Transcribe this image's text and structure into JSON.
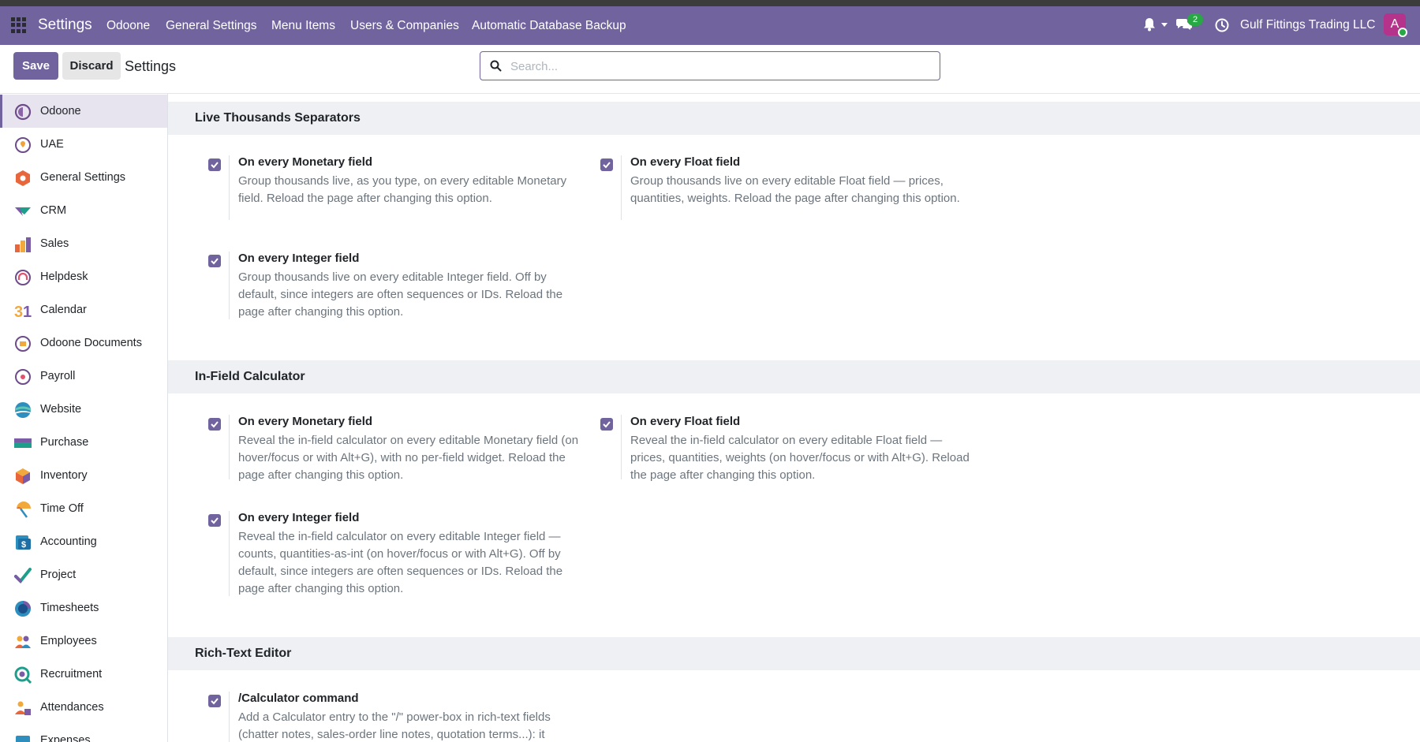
{
  "navbar": {
    "brand": "Settings",
    "menus": [
      "Odoone",
      "General Settings",
      "Menu Items",
      "Users & Companies",
      "Automatic Database Backup"
    ],
    "messages_count": "2",
    "company": "Gulf Fittings Trading LLC",
    "avatar_letter": "A"
  },
  "controls": {
    "save": "Save",
    "discard": "Discard",
    "title": "Settings",
    "search_placeholder": "Search..."
  },
  "sidebar": {
    "items": [
      {
        "label": "Odoone",
        "icon": "odoone-icon",
        "active": true
      },
      {
        "label": "UAE",
        "icon": "uae-icon"
      },
      {
        "label": "General Settings",
        "icon": "general-settings-icon"
      },
      {
        "label": "CRM",
        "icon": "crm-icon"
      },
      {
        "label": "Sales",
        "icon": "sales-icon"
      },
      {
        "label": "Helpdesk",
        "icon": "helpdesk-icon"
      },
      {
        "label": "Calendar",
        "icon": "calendar-icon"
      },
      {
        "label": "Odoone Documents",
        "icon": "documents-icon"
      },
      {
        "label": "Payroll",
        "icon": "payroll-icon"
      },
      {
        "label": "Website",
        "icon": "website-icon"
      },
      {
        "label": "Purchase",
        "icon": "purchase-icon"
      },
      {
        "label": "Inventory",
        "icon": "inventory-icon"
      },
      {
        "label": "Time Off",
        "icon": "time-off-icon"
      },
      {
        "label": "Accounting",
        "icon": "accounting-icon"
      },
      {
        "label": "Project",
        "icon": "project-icon"
      },
      {
        "label": "Timesheets",
        "icon": "timesheets-icon"
      },
      {
        "label": "Employees",
        "icon": "employees-icon"
      },
      {
        "label": "Recruitment",
        "icon": "recruitment-icon"
      },
      {
        "label": "Attendances",
        "icon": "attendances-icon"
      },
      {
        "label": "Expenses",
        "icon": "expenses-icon"
      }
    ]
  },
  "sections": [
    {
      "title": "Live Thousands Separators",
      "settings": [
        {
          "title": "On every Monetary field",
          "checked": true,
          "desc": "Group thousands live, as you type, on every editable Monetary field. Reload the page after changing this option."
        },
        {
          "title": "On every Float field",
          "checked": true,
          "desc": "Group thousands live on every editable Float field — prices, quantities, weights. Reload the page after changing this option."
        },
        {
          "title": "On every Integer field",
          "checked": true,
          "desc": "Group thousands live on every editable Integer field. Off by default, since integers are often sequences or IDs. Reload the page after changing this option."
        }
      ]
    },
    {
      "title": "In-Field Calculator",
      "settings": [
        {
          "title": "On every Monetary field",
          "checked": true,
          "desc": "Reveal the in-field calculator on every editable Monetary field (on hover/focus or with Alt+G), with no per-field widget. Reload the page after changing this option."
        },
        {
          "title": "On every Float field",
          "checked": true,
          "desc": "Reveal the in-field calculator on every editable Float field — prices, quantities, weights (on hover/focus or with Alt+G). Reload the page after changing this option."
        },
        {
          "title": "On every Integer field",
          "checked": true,
          "desc": "Reveal the in-field calculator on every editable Integer field — counts, quantities-as-int (on hover/focus or with Alt+G). Off by default, since integers are often sequences or IDs. Reload the page after changing this option."
        }
      ]
    },
    {
      "title": "Rich-Text Editor",
      "settings": [
        {
          "title": "/Calculator command",
          "checked": true,
          "desc": "Add a Calculator entry to the \"/\" power-box in rich-text fields (chatter notes, sales-order line notes, quotation terms...): it"
        }
      ]
    }
  ]
}
